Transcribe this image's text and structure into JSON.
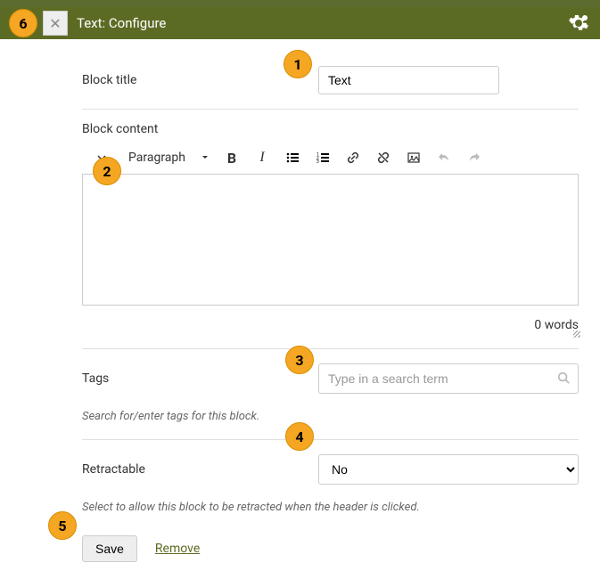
{
  "header": {
    "title": "Text: Configure"
  },
  "form": {
    "block_title_label": "Block title",
    "block_title_value": "Text",
    "block_content_label": "Block content",
    "format_label": "Paragraph",
    "wordcount": "0 words",
    "tags_label": "Tags",
    "tags_placeholder": "Type in a search term",
    "tags_help": "Search for/enter tags for this block.",
    "retractable_label": "Retractable",
    "retractable_value": "No",
    "retractable_help": "Select to allow this block to be retracted when the header is clicked."
  },
  "actions": {
    "save": "Save",
    "remove": "Remove"
  },
  "markers": {
    "m1": "1",
    "m2": "2",
    "m3": "3",
    "m4": "4",
    "m5": "5",
    "m6": "6"
  }
}
